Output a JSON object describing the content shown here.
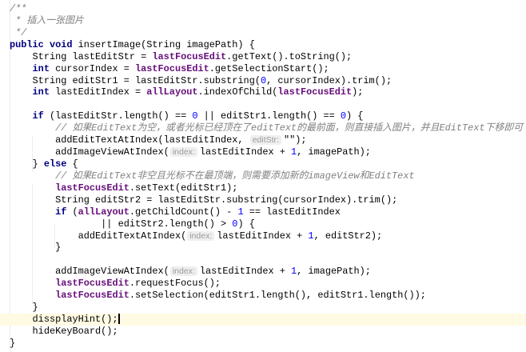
{
  "editor": {
    "current_line": 27,
    "lines": [
      {
        "indent": 0,
        "tokens": [
          [
            "doc",
            "/**"
          ]
        ]
      },
      {
        "indent": 0,
        "tokens": [
          [
            "doc",
            " * 插入一张图片"
          ]
        ]
      },
      {
        "indent": 0,
        "tokens": [
          [
            "doc",
            " */"
          ]
        ]
      },
      {
        "indent": 0,
        "tokens": [
          [
            "kw",
            "public void "
          ],
          [
            "plain",
            "insertImage(String imagePath) {"
          ]
        ]
      },
      {
        "indent": 4,
        "tokens": [
          [
            "plain",
            "String lastEditStr = "
          ],
          [
            "field",
            "lastFocusEdit"
          ],
          [
            "plain",
            ".getText().toString();"
          ]
        ]
      },
      {
        "indent": 4,
        "tokens": [
          [
            "kw",
            "int "
          ],
          [
            "plain",
            "cursorIndex = "
          ],
          [
            "field",
            "lastFocusEdit"
          ],
          [
            "plain",
            ".getSelectionStart();"
          ]
        ]
      },
      {
        "indent": 4,
        "tokens": [
          [
            "plain",
            "String editStr1 = lastEditStr.substring("
          ],
          [
            "num",
            "0"
          ],
          [
            "plain",
            ", cursorIndex).trim();"
          ]
        ]
      },
      {
        "indent": 4,
        "tokens": [
          [
            "kw",
            "int "
          ],
          [
            "plain",
            "lastEditIndex = "
          ],
          [
            "field",
            "allLayout"
          ],
          [
            "plain",
            ".indexOfChild("
          ],
          [
            "field",
            "lastFocusEdit"
          ],
          [
            "plain",
            ");"
          ]
        ]
      },
      {
        "indent": 0,
        "tokens": []
      },
      {
        "indent": 4,
        "tokens": [
          [
            "kw",
            "if "
          ],
          [
            "plain",
            "(lastEditStr.length() == "
          ],
          [
            "num",
            "0"
          ],
          [
            "plain",
            " || editStr1.length() == "
          ],
          [
            "num",
            "0"
          ],
          [
            "plain",
            ") {"
          ]
        ]
      },
      {
        "indent": 8,
        "tokens": [
          [
            "cm",
            "// 如果EditText为空，或者光标已经顶在了editText的最前面，则直接插入图片，并且EditText下移即可"
          ]
        ]
      },
      {
        "indent": 8,
        "tokens": [
          [
            "plain",
            "addEditTextAtIndex(lastEditIndex, "
          ],
          [
            "hint",
            "editStr:"
          ],
          [
            "plain",
            "\"\");"
          ]
        ]
      },
      {
        "indent": 8,
        "tokens": [
          [
            "plain",
            "addImageViewAtIndex("
          ],
          [
            "hint",
            "index:"
          ],
          [
            "plain",
            "lastEditIndex + "
          ],
          [
            "num",
            "1"
          ],
          [
            "plain",
            ", imagePath);"
          ]
        ]
      },
      {
        "indent": 4,
        "tokens": [
          [
            "plain",
            "} "
          ],
          [
            "kw",
            "else "
          ],
          [
            "plain",
            "{"
          ]
        ]
      },
      {
        "indent": 8,
        "tokens": [
          [
            "cm",
            "// 如果EditText非空且光标不在最顶端，则需要添加新的imageView和EditText"
          ]
        ]
      },
      {
        "indent": 8,
        "tokens": [
          [
            "field",
            "lastFocusEdit"
          ],
          [
            "plain",
            ".setText(editStr1);"
          ]
        ]
      },
      {
        "indent": 8,
        "tokens": [
          [
            "plain",
            "String editStr2 = lastEditStr.substring(cursorIndex).trim();"
          ]
        ]
      },
      {
        "indent": 8,
        "tokens": [
          [
            "kw",
            "if "
          ],
          [
            "plain",
            "("
          ],
          [
            "field",
            "allLayout"
          ],
          [
            "plain",
            ".getChildCount() - "
          ],
          [
            "num",
            "1"
          ],
          [
            "plain",
            " == lastEditIndex"
          ]
        ]
      },
      {
        "indent": 16,
        "tokens": [
          [
            "plain",
            "|| editStr2.length() > "
          ],
          [
            "num",
            "0"
          ],
          [
            "plain",
            ") {"
          ]
        ]
      },
      {
        "indent": 12,
        "tokens": [
          [
            "plain",
            "addEditTextAtIndex("
          ],
          [
            "hint",
            "index:"
          ],
          [
            "plain",
            "lastEditIndex + "
          ],
          [
            "num",
            "1"
          ],
          [
            "plain",
            ", editStr2);"
          ]
        ]
      },
      {
        "indent": 8,
        "tokens": [
          [
            "plain",
            "}"
          ]
        ]
      },
      {
        "indent": 0,
        "tokens": []
      },
      {
        "indent": 8,
        "tokens": [
          [
            "plain",
            "addImageViewAtIndex("
          ],
          [
            "hint",
            "index:"
          ],
          [
            "plain",
            "lastEditIndex + "
          ],
          [
            "num",
            "1"
          ],
          [
            "plain",
            ", imagePath);"
          ]
        ]
      },
      {
        "indent": 8,
        "tokens": [
          [
            "field",
            "lastFocusEdit"
          ],
          [
            "plain",
            ".requestFocus();"
          ]
        ]
      },
      {
        "indent": 8,
        "tokens": [
          [
            "field",
            "lastFocusEdit"
          ],
          [
            "plain",
            ".setSelection(editStr1.length(), editStr1.length());"
          ]
        ]
      },
      {
        "indent": 4,
        "tokens": [
          [
            "plain",
            "}"
          ]
        ]
      },
      {
        "indent": 4,
        "tokens": [
          [
            "plain",
            "dissplayHint();"
          ]
        ]
      },
      {
        "indent": 4,
        "tokens": [
          [
            "plain",
            "hideKeyBoard();"
          ]
        ]
      },
      {
        "indent": 0,
        "tokens": [
          [
            "plain",
            "}"
          ]
        ]
      }
    ]
  }
}
